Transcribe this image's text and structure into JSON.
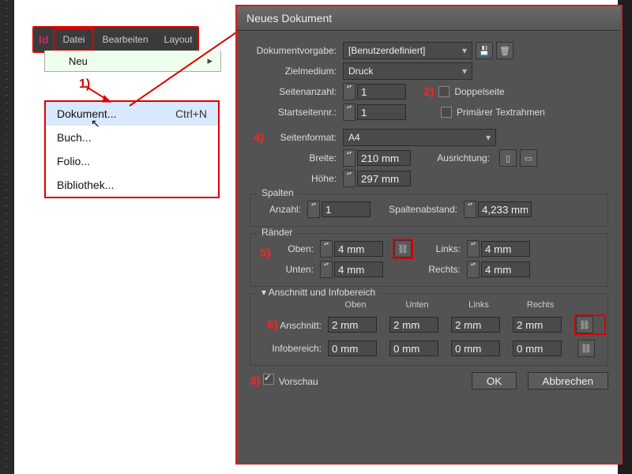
{
  "menubar": {
    "logo": "Id",
    "items": [
      "Datei",
      "Bearbeiten",
      "Layout"
    ],
    "neu": "Neu"
  },
  "submenu": [
    {
      "label": "Dokument...",
      "shortcut": "Ctrl+N"
    },
    {
      "label": "Buch..."
    },
    {
      "label": "Folio..."
    },
    {
      "label": "Bibliothek..."
    }
  ],
  "annotations": {
    "1": "1)",
    "2": "2)",
    "3": "3)",
    "4": "4)",
    "5": "5)",
    "6": "6)"
  },
  "dialog": {
    "title": "Neues Dokument",
    "preset_label": "Dokumentvorgabe:",
    "preset_value": "[Benutzerdefiniert]",
    "intent_label": "Zielmedium:",
    "intent_value": "Druck",
    "pages_label": "Seitenanzahl:",
    "pages_value": "1",
    "facing_label": "Doppelseite",
    "start_label": "Startseitennr.:",
    "start_value": "1",
    "primary_label": "Primärer Textrahmen",
    "size_label": "Seitenformat:",
    "size_value": "A4",
    "width_label": "Breite:",
    "width_value": "210 mm",
    "height_label": "Höhe:",
    "height_value": "297 mm",
    "orient_label": "Ausrichtung:",
    "columns_title": "Spalten",
    "col_count_label": "Anzahl:",
    "col_count_value": "1",
    "gutter_label": "Spaltenabstand:",
    "gutter_value": "4,233 mm",
    "margins_title": "Ränder",
    "top_label": "Oben:",
    "bottom_label": "Unten:",
    "left_label": "Links:",
    "right_label": "Rechts:",
    "margin_value": "4 mm",
    "bleed_title": "Anschnitt und Infobereich",
    "col_top": "Oben",
    "col_bottom": "Unten",
    "col_left": "Links",
    "col_right": "Rechts",
    "bleed_label": "Anschnitt:",
    "bleed_value": "2 mm",
    "slug_label": "Infobereich:",
    "slug_value": "0 mm",
    "preview": "Vorschau",
    "ok": "OK",
    "cancel": "Abbrechen"
  }
}
